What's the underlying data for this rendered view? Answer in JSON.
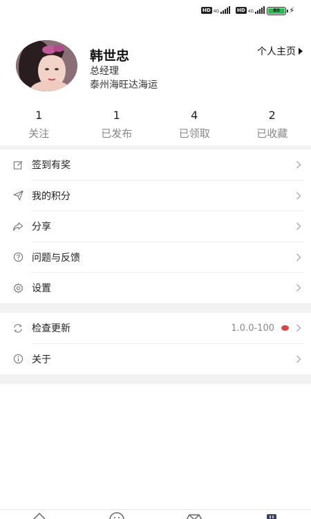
{
  "status_bar": {
    "network_labels": [
      "HD",
      "4G",
      "HD",
      "4G"
    ],
    "battery": "80"
  },
  "profile": {
    "name": "韩世忠",
    "title": "总经理",
    "company": "泰州海旺达海运",
    "homepage_link": "个人主页"
  },
  "stats": [
    {
      "value": "1",
      "label": "关注"
    },
    {
      "value": "1",
      "label": "已发布"
    },
    {
      "value": "4",
      "label": "已领取"
    },
    {
      "value": "2",
      "label": "已收藏"
    }
  ],
  "menu_group1": [
    {
      "label": "签到有奖",
      "icon": "edit-icon"
    },
    {
      "label": "我的积分",
      "icon": "send-icon"
    },
    {
      "label": "分享",
      "icon": "share-icon"
    },
    {
      "label": "问题与反馈",
      "icon": "question-icon"
    },
    {
      "label": "设置",
      "icon": "gear-icon"
    }
  ],
  "menu_group2": [
    {
      "label": "检查更新",
      "icon": "refresh-icon",
      "value": "1.0.0-100"
    },
    {
      "label": "关于",
      "icon": "info-icon"
    }
  ],
  "colors": {
    "update_dot": "#d04a4a",
    "battery": "#2db84c",
    "divider": "#f2f2f2"
  }
}
